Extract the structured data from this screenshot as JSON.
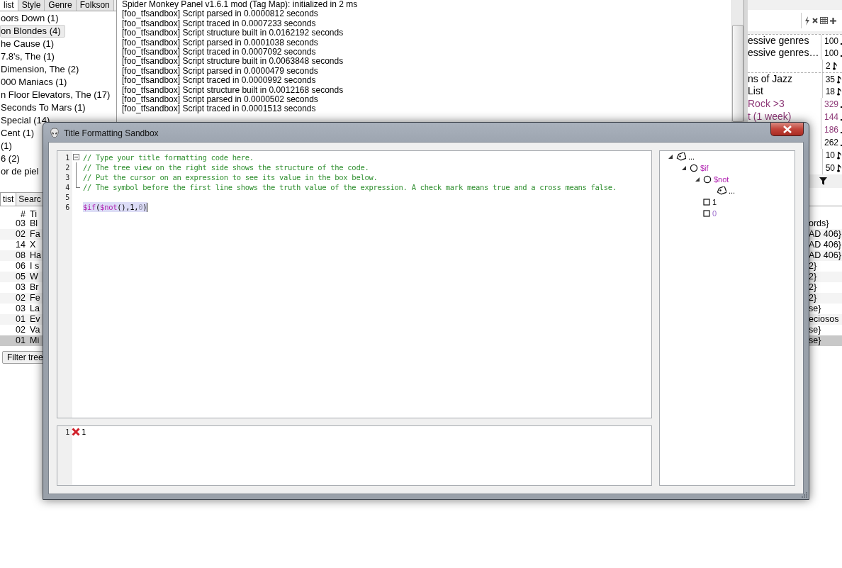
{
  "library_panel": {
    "tabs": [
      {
        "label": "list",
        "selected": true
      },
      {
        "label": "Style",
        "selected": false
      },
      {
        "label": "Genre",
        "selected": false
      },
      {
        "label": "Folkson",
        "selected": false
      }
    ],
    "items": [
      {
        "label": "oors Down (1)",
        "selected": false
      },
      {
        "label": "on Blondes (4)",
        "selected": true
      },
      {
        "label": "he Cause (1)",
        "selected": false
      },
      {
        "label": "7.8's, The (1)",
        "selected": false
      },
      {
        "label": "Dimension, The (2)",
        "selected": false
      },
      {
        "label": "000 Maniacs (1)",
        "selected": false
      },
      {
        "label": "n Floor Elevators, The (17)",
        "selected": false
      },
      {
        "label": "Seconds To Mars (1)",
        "selected": false
      },
      {
        "label": "Special (14)",
        "selected": false
      },
      {
        "label": "Cent (1)",
        "selected": false
      },
      {
        "label": "(1)",
        "selected": false
      },
      {
        "label": "6 (2)",
        "selected": false
      },
      {
        "label": "or de piel",
        "selected": false
      }
    ]
  },
  "console": {
    "lines": [
      "Spider Monkey Panel v1.6.1 mod (Tag Map): initialized in 2 ms",
      "[foo_tfsandbox] Script parsed in 0.0000812 seconds",
      "[foo_tfsandbox] Script traced in 0.0007233 seconds",
      "[foo_tfsandbox] Script structure built in 0.0162192 seconds",
      "[foo_tfsandbox] Script parsed in 0.0001038 seconds",
      "[foo_tfsandbox] Script traced in 0.0007092 seconds",
      "[foo_tfsandbox] Script structure built in 0.0063848 seconds",
      "[foo_tfsandbox] Script parsed in 0.0000479 seconds",
      "[foo_tfsandbox] Script traced in 0.0000992 seconds",
      "[foo_tfsandbox] Script structure built in 0.0012168 seconds",
      "[foo_tfsandbox] Script parsed in 0.0000502 seconds",
      "[foo_tfsandbox] Script traced in 0.0001513 seconds"
    ]
  },
  "tag_panel": {
    "rows": [
      {
        "name": "essive genres",
        "count": "100",
        "kind": "dot",
        "color": "#000000",
        "group_start": true
      },
      {
        "name": "essive genres…",
        "count": "100",
        "kind": "dot",
        "color": "#000000",
        "group_start": false
      },
      {
        "count": "2",
        "kind": "note",
        "color": "#000000",
        "group_start": false
      },
      {
        "name": "ns of Jazz",
        "count": "35",
        "kind": "note",
        "color": "#000000",
        "group_start": true
      },
      {
        "name": "List",
        "count": "18",
        "kind": "note",
        "color": "#000000",
        "group_start": false
      },
      {
        "name": "Rock >3",
        "count": "329",
        "kind": "dot",
        "color": "#8e3a78",
        "group_start": false
      },
      {
        "name": "t (1 week)",
        "count": "144",
        "kind": "dot",
        "color": "#8e3a78",
        "group_start": false
      },
      {
        "count": "186",
        "kind": "dot",
        "color": "#8e3a78",
        "group_start": false
      },
      {
        "count": "262",
        "kind": "dot",
        "color": "#000000",
        "group_start": false
      },
      {
        "count": "10",
        "kind": "note",
        "color": "#000000",
        "group_start": false
      },
      {
        "count": "50",
        "kind": "note",
        "color": "#000000",
        "group_start": false
      }
    ]
  },
  "playlist": {
    "tabs": [
      {
        "label": "tist",
        "selected": true
      },
      {
        "label": "Searc",
        "selected": false
      }
    ],
    "columns": [
      "#",
      "Ti"
    ],
    "rows": [
      {
        "number": "03",
        "title": "Bl",
        "column_3": "ords}",
        "selected": false
      },
      {
        "number": "02",
        "title": "Fa",
        "column_3": "AD 406}",
        "selected": false
      },
      {
        "number": "14",
        "title": "X",
        "column_3": "AD 406}",
        "selected": false
      },
      {
        "number": "08",
        "title": "Ha",
        "column_3": "AD 406}",
        "selected": false
      },
      {
        "number": "06",
        "title": "I s",
        "column_3": "2}",
        "selected": false
      },
      {
        "number": "05",
        "title": "W",
        "column_3": "2}",
        "selected": false
      },
      {
        "number": "03",
        "title": "Br",
        "column_3": "2}",
        "selected": false
      },
      {
        "number": "02",
        "title": "Fe",
        "column_3": "2}",
        "selected": false
      },
      {
        "number": "03",
        "title": "La",
        "column_3": "se}",
        "selected": false
      },
      {
        "number": "01",
        "title": "Ev",
        "column_3": "eciosos",
        "selected": false
      },
      {
        "number": "02",
        "title": "Va",
        "column_3": "se}",
        "selected": false
      },
      {
        "number": "01",
        "title": "Mi",
        "column_3": "se}",
        "selected": true
      }
    ],
    "filter_button": "Filter tree"
  },
  "dialog": {
    "title": "Title Formatting Sandbox",
    "code_lines": [
      {
        "number": "1",
        "kind": "fold_start",
        "highlighted": false,
        "segments": [
          {
            "text": "// Type your title formatting code here.",
            "kind": "comment"
          }
        ]
      },
      {
        "number": "2",
        "kind": "fold_middle",
        "highlighted": false,
        "segments": [
          {
            "text": "// The tree view on the right side shows the structure of the code.",
            "kind": "comment"
          }
        ]
      },
      {
        "number": "3",
        "kind": "fold_middle",
        "highlighted": false,
        "segments": [
          {
            "text": "// Put the cursor on an expression to see its value in the box below.",
            "kind": "comment"
          }
        ]
      },
      {
        "number": "4",
        "kind": "fold_end",
        "highlighted": false,
        "segments": [
          {
            "text": "// The symbol before the first line shows the truth value of the expression. A check mark means true and a cross means false.",
            "kind": "comment"
          }
        ]
      },
      {
        "number": "5",
        "kind": "plain"
      },
      {
        "number": "6",
        "kind": "plain",
        "highlighted": true,
        "caret": true,
        "segments": [
          {
            "text": "$if",
            "kind": "function"
          },
          {
            "text": "(",
            "kind": "text"
          },
          {
            "text": "$not",
            "kind": "function"
          },
          {
            "text": "(),1,",
            "kind": "text"
          },
          {
            "text": "0",
            "kind": "dim"
          },
          {
            "text": ")",
            "kind": "text"
          }
        ]
      }
    ],
    "output": {
      "number": "1",
      "truth": false,
      "value": "1"
    },
    "tree": [
      {
        "label": "...",
        "kind": "field",
        "expanded": true,
        "children": [
          {
            "label": "$if",
            "kind": "function",
            "expanded": true,
            "children": [
              {
                "label": "$not",
                "kind": "function",
                "expanded": true,
                "children": [
                  {
                    "label": "...",
                    "kind": "field"
                  }
                ]
              },
              {
                "label": "1",
                "kind": "literal"
              },
              {
                "label": "0",
                "kind": "zero"
              }
            ]
          }
        ]
      }
    ]
  }
}
